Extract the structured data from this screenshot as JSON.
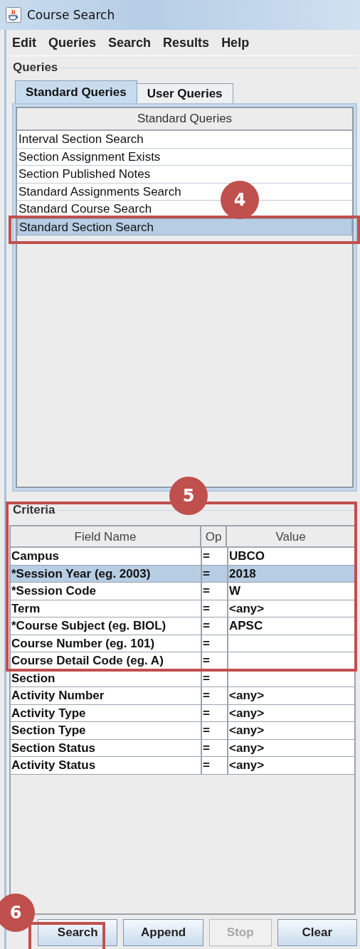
{
  "window": {
    "title": "Course Search"
  },
  "menu": [
    {
      "label": "Edit"
    },
    {
      "label": "Queries"
    },
    {
      "label": "Search"
    },
    {
      "label": "Results"
    },
    {
      "label": "Help"
    }
  ],
  "queries": {
    "title": "Queries",
    "tabs": [
      {
        "label": "Standard Queries",
        "selected": true
      },
      {
        "label": "User Queries",
        "selected": false
      }
    ],
    "list_header": "Standard Queries",
    "items": [
      {
        "label": "Interval Section Search",
        "selected": false
      },
      {
        "label": "Section Assignment Exists",
        "selected": false
      },
      {
        "label": "Section Published Notes",
        "selected": false
      },
      {
        "label": "Standard Assignments Search",
        "selected": false
      },
      {
        "label": "Standard Course Search",
        "selected": false
      },
      {
        "label": "Standard Section Search",
        "selected": true
      }
    ]
  },
  "criteria": {
    "title": "Criteria",
    "columns": [
      "Field Name",
      "Op",
      "Value"
    ],
    "rows": [
      {
        "field": "Campus",
        "op": "=",
        "value": "UBCO",
        "selected": false
      },
      {
        "field": "*Session Year (eg. 2003)",
        "op": "=",
        "value": "2018",
        "selected": true
      },
      {
        "field": "*Session Code",
        "op": "=",
        "value": "W",
        "selected": false
      },
      {
        "field": "Term",
        "op": "=",
        "value": "<any>",
        "selected": false
      },
      {
        "field": "*Course Subject (eg. BIOL)",
        "op": "=",
        "value": "APSC",
        "selected": false
      },
      {
        "field": "Course Number (eg. 101)",
        "op": "=",
        "selected": false
      },
      {
        "field": "Course Detail Code (eg. A)",
        "op": "=",
        "selected": false
      },
      {
        "field": "Section",
        "op": "=",
        "selected": false
      },
      {
        "field": "Activity Number",
        "op": "=",
        "value": "<any>",
        "selected": false
      },
      {
        "field": "Activity Type",
        "op": "=",
        "value": "<any>",
        "selected": false
      },
      {
        "field": "Section Type",
        "op": "=",
        "value": "<any>",
        "selected": false
      },
      {
        "field": "Section Status",
        "op": "=",
        "value": "<any>",
        "selected": false
      },
      {
        "field": "Activity Status",
        "op": "=",
        "value": "<any>",
        "selected": false
      }
    ]
  },
  "buttons": [
    {
      "label": "Search",
      "disabled": false
    },
    {
      "label": "Append",
      "disabled": false
    },
    {
      "label": "Stop",
      "disabled": true
    },
    {
      "label": "Clear",
      "disabled": false
    }
  ],
  "callouts": [
    {
      "label": "4"
    },
    {
      "label": "5"
    },
    {
      "label": "6"
    }
  ]
}
